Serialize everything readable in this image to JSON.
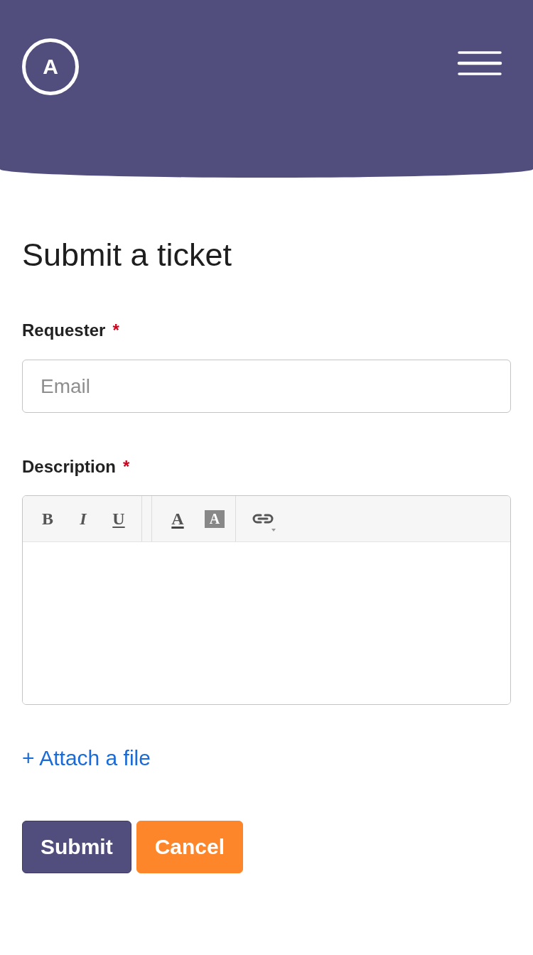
{
  "header": {
    "logo_letter": "A"
  },
  "title": "Submit a ticket",
  "fields": [
    {
      "kind": "text",
      "label": "Requester",
      "required_mark": "*",
      "placeholder": "Email"
    },
    {
      "kind": "editor",
      "label": "Description",
      "required_mark": "*",
      "toolbar": [
        [
          {
            "kind": "bold",
            "label": "B"
          },
          {
            "kind": "italic",
            "label": "I"
          },
          {
            "kind": "underline",
            "label": "U"
          }
        ],
        [
          {
            "kind": "text-color",
            "label": "A"
          },
          {
            "kind": "highlight",
            "label": "A"
          }
        ],
        [
          {
            "kind": "link"
          }
        ]
      ]
    }
  ],
  "attach_link": "+ Attach a file",
  "buttons": [
    {
      "kind": "primary",
      "label": "Submit"
    },
    {
      "kind": "secondary",
      "label": "Cancel"
    }
  ]
}
